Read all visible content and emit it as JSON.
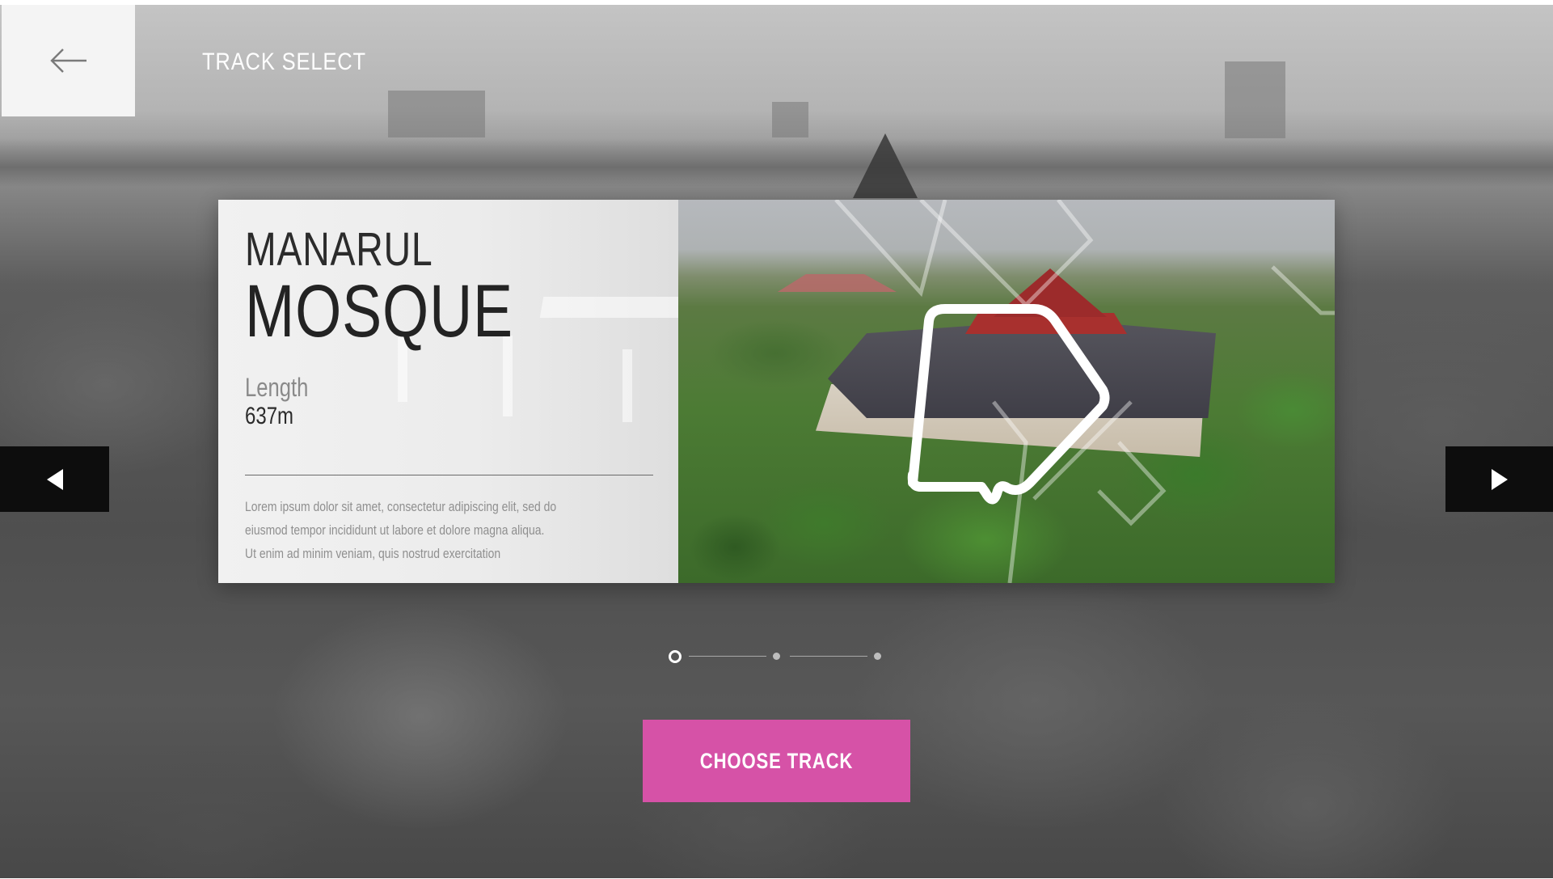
{
  "header": {
    "back_icon": "arrow-left-icon",
    "title": "TRACK SELECT"
  },
  "track": {
    "name_line1": "MANARUL",
    "name_line2": "MOSQUE",
    "length_label": "Length",
    "length_value": "637m",
    "description": "Lorem ipsum dolor sit amet, consectetur adipiscing elit, sed do eiusmod tempor incididunt ut labore et dolore magna aliqua. Ut enim ad minim veniam, quis nostrud exercitation",
    "photo_icon": "mosque-photo",
    "track_outline_icon": "track-outline-icon"
  },
  "navigation": {
    "prev_icon": "triangle-left-icon",
    "next_icon": "triangle-right-icon"
  },
  "pagination": {
    "total": 3,
    "active_index": 0
  },
  "actions": {
    "choose_label": "CHOOSE TRACK"
  },
  "colors": {
    "accent": "#d652a7",
    "arrow_bg": "#0d0d0d",
    "panel_bg": "#eeeeee"
  }
}
